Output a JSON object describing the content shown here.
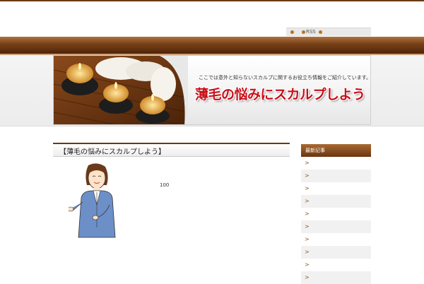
{
  "topnav": {
    "rss_label": "RSS"
  },
  "banner": {
    "tagline": "ここでは意外と知らないスカルプに関するお役立ち情報をご紹介しています。",
    "headline": "薄毛の悩みにスカルプしよう"
  },
  "post": {
    "title": "【薄毛の悩みにスカルプしよう】",
    "number": "100"
  },
  "sidebar": {
    "heading": "最新記事",
    "items": [
      ">",
      ">",
      ">",
      ">",
      ">",
      ">",
      ">",
      ">",
      ">",
      ">"
    ]
  }
}
